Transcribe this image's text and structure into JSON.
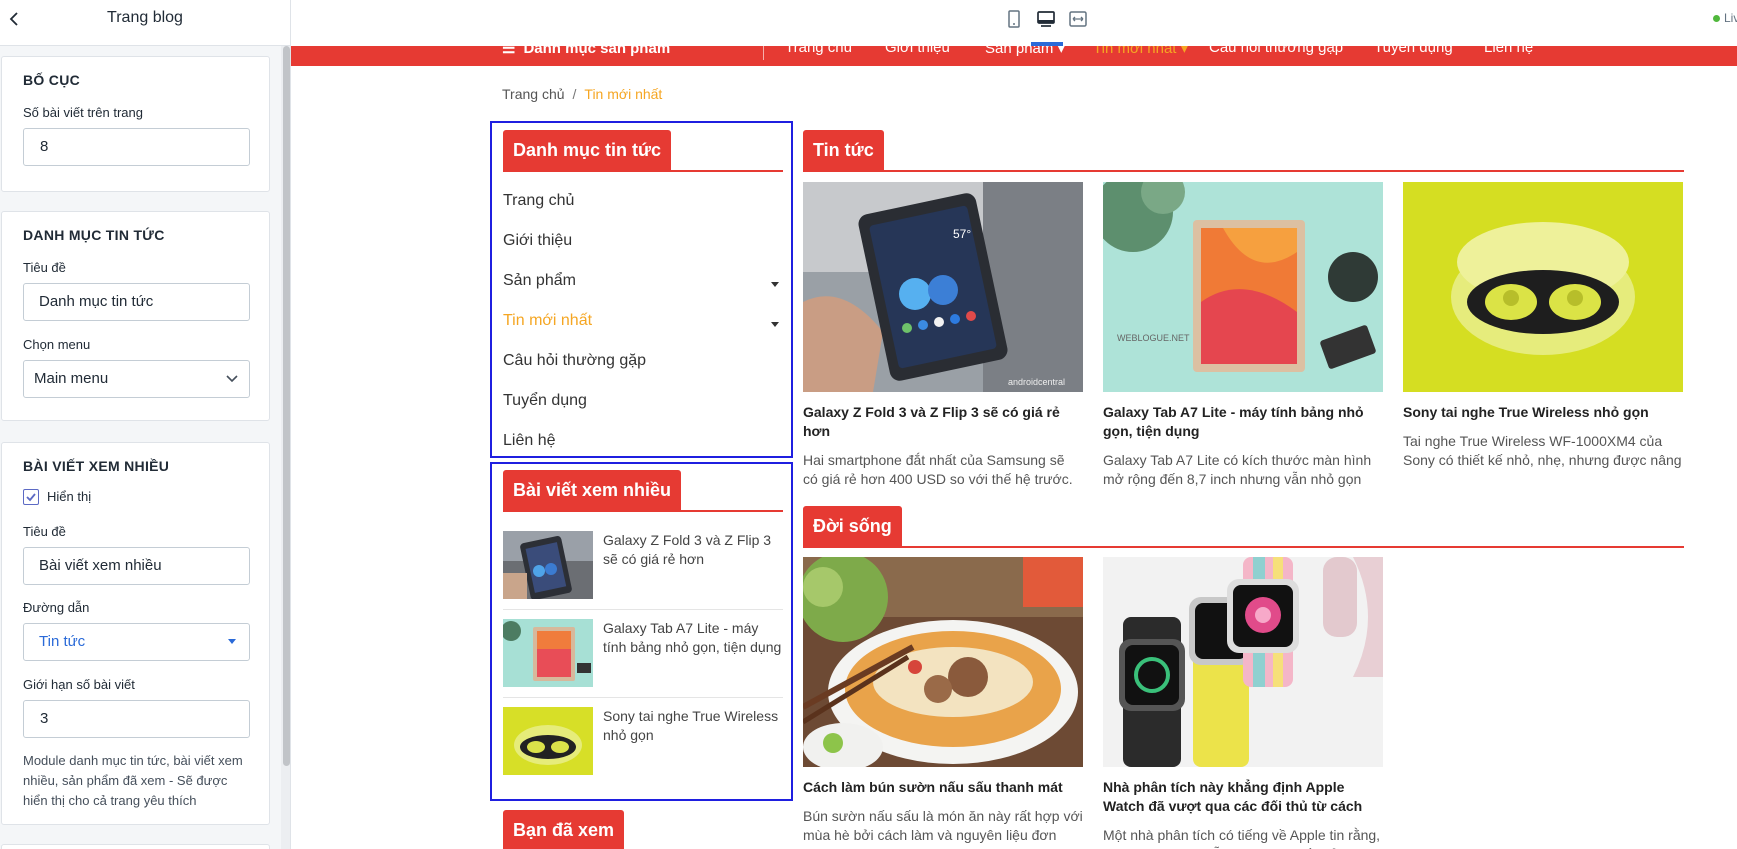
{
  "sidebar": {
    "title": "Trang blog",
    "layout_card": {
      "heading": "BỐ CỤC",
      "posts_per_page_label": "Số bài viết trên trang",
      "posts_per_page_value": "8"
    },
    "category_card": {
      "heading": "DANH MỤC TIN TỨC",
      "title_label": "Tiêu đề",
      "title_value": "Danh mục tin tức",
      "menu_label": "Chọn menu",
      "menu_value": "Main menu"
    },
    "popular_card": {
      "heading": "BÀI VIẾT XEM NHIỀU",
      "show_label": "Hiển thị",
      "show_checked": true,
      "title_label": "Tiêu đề",
      "title_value": "Bài viết xem nhiều",
      "link_label": "Đường dẫn",
      "link_value": "Tin tức",
      "limit_label": "Giới hạn số bài viết",
      "limit_value": "3",
      "note": "Module danh mục tin tức, bài viết xem nhiều, sản phẩm đã xem - Sẽ được hiển thị cho cả trang yêu thích"
    }
  },
  "topbar": {
    "devices": [
      "mobile-icon",
      "desktop-icon",
      "fullwidth-icon"
    ],
    "active_device": "desktop-icon",
    "live_label": "Live"
  },
  "preview": {
    "navbar": {
      "categories_label": "Danh mục sản phẩm",
      "items": [
        "Trang chủ",
        "Giới thiệu",
        "Sản phẩm",
        "Tin mới nhất",
        "Câu hỏi thường gặp",
        "Tuyển dụng",
        "Liên hệ"
      ],
      "active": "Tin mới nhất"
    },
    "breadcrumb": {
      "home": "Trang chủ",
      "current": "Tin mới nhất"
    },
    "category_widget": {
      "title": "Danh mục tin tức",
      "items": [
        "Trang chủ",
        "Giới thiệu",
        "Sản phẩm",
        "Tin mới nhất",
        "Câu hỏi thường gặp",
        "Tuyển dụng",
        "Liên hệ"
      ],
      "active": "Tin mới nhất"
    },
    "popular_widget": {
      "title": "Bài viết xem nhiều",
      "posts": [
        {
          "title": "Galaxy Z Fold 3 và Z Flip 3 sẽ có giá rẻ hơn"
        },
        {
          "title": "Galaxy Tab A7 Lite - máy tính bảng nhỏ gọn, tiện dụng"
        },
        {
          "title": "Sony tai nghe True Wireless nhỏ gọn"
        }
      ]
    },
    "viewed_widget": {
      "title": "Bạn đã xem"
    },
    "news_section": {
      "title": "Tin tức",
      "posts": [
        {
          "title": "Galaxy Z Fold 3 và Z Flip 3 sẽ có giá rẻ hơn",
          "desc": "Hai smartphone đắt nhất của Samsung sẽ có giá rẻ hơn 400 USD so với thế hệ trước.",
          "img_caption": "androidcentral"
        },
        {
          "title": "Galaxy Tab A7 Lite - máy tính bảng nhỏ gọn, tiện dụng",
          "desc": "Galaxy Tab A7 Lite có kích thước màn hình mở rộng đến 8,7 inch nhưng vẫn nhỏ gọn",
          "img_caption": "WEBLOGUE.NET"
        },
        {
          "title": "Sony tai nghe True Wireless nhỏ gọn",
          "desc": "Tai nghe True Wireless WF-1000XM4 của Sony có thiết kế nhỏ, nhẹ, nhưng được nâng"
        }
      ]
    },
    "life_section": {
      "title": "Đời sống",
      "posts": [
        {
          "title": "Cách làm bún sườn nấu sấu thanh mát",
          "desc": "Bún sườn nấu sấu là món ăn này rất hợp với mùa hè bởi cách làm và nguyên liệu đơn"
        },
        {
          "title": "Nhà phân tích này khẳng định Apple Watch đã vượt qua các đối thủ từ cách",
          "desc": "Một nhà phân tích có tiếng về Apple tin rằng, Apple Watch đã dẫn trước các đối thủ trên"
        }
      ]
    },
    "colors": {
      "brand_red": "#e63a33",
      "active_orange": "#f5a623",
      "highlight_blue": "#1f1fe0"
    }
  }
}
